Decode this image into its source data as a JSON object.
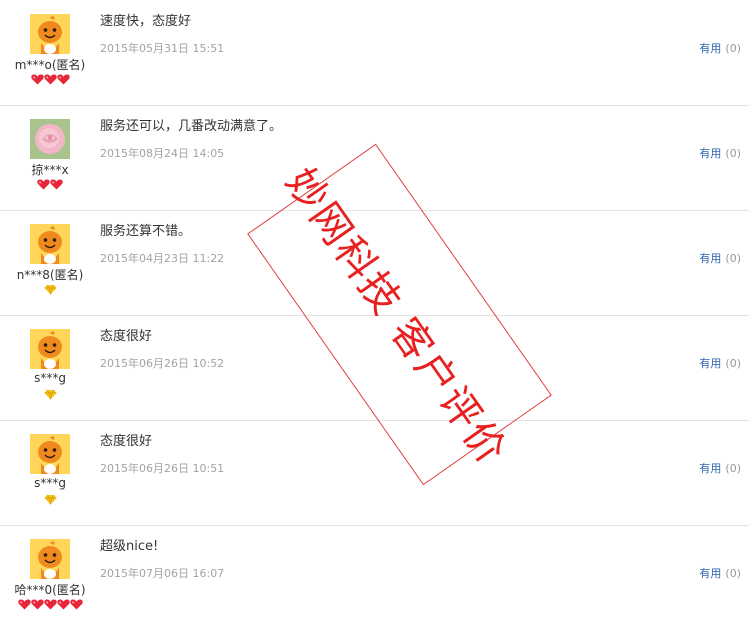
{
  "reviews": [
    {
      "nickname": "m***o(匿名)",
      "content": "速度快，态度好",
      "date": "2015年05月31日 15:51",
      "useful_label": "有用",
      "useful_count": "(0)",
      "avatar_icon": "orange-mascot-avatar-icon",
      "badge_icon": "red-heart-badge-icon",
      "badge_count": 3
    },
    {
      "nickname": "掠***x",
      "content": "服务还可以，几番改动满意了。",
      "date": "2015年08月24日 14:05",
      "useful_label": "有用",
      "useful_count": "(0)",
      "avatar_icon": "pink-rose-avatar-icon",
      "badge_icon": "red-heart-badge-icon",
      "badge_count": 2
    },
    {
      "nickname": "n***8(匿名)",
      "content": "服务还算不错。",
      "date": "2015年04月23日 11:22",
      "useful_label": "有用",
      "useful_count": "(0)",
      "avatar_icon": "orange-mascot-avatar-icon",
      "badge_icon": "yellow-diamond-badge-icon",
      "badge_count": 1
    },
    {
      "nickname": "s***g",
      "content": "态度很好",
      "date": "2015年06月26日 10:52",
      "useful_label": "有用",
      "useful_count": "(0)",
      "avatar_icon": "orange-mascot-avatar-icon",
      "badge_icon": "yellow-diamond-badge-icon",
      "badge_count": 1
    },
    {
      "nickname": "s***g",
      "content": "态度很好",
      "date": "2015年06月26日 10:51",
      "useful_label": "有用",
      "useful_count": "(0)",
      "avatar_icon": "orange-mascot-avatar-icon",
      "badge_icon": "yellow-diamond-badge-icon",
      "badge_count": 1
    },
    {
      "nickname": "哈***0(匿名)",
      "content": "超级nice!",
      "date": "2015年07月06日 16:07",
      "useful_label": "有用",
      "useful_count": "(0)",
      "avatar_icon": "orange-mascot-avatar-icon",
      "badge_icon": "red-heart-badge-icon",
      "badge_count": 5
    }
  ],
  "stamp": {
    "text": "妙网科技 客户评价",
    "color": "#e82020"
  },
  "colors": {
    "link": "#2e66b0",
    "date": "#a3a3a3",
    "divider": "#e4e4e4",
    "mascot_orange": "#f08a1c",
    "heart_red": "#e8263a",
    "diamond_yellow": "#f5c21a"
  }
}
